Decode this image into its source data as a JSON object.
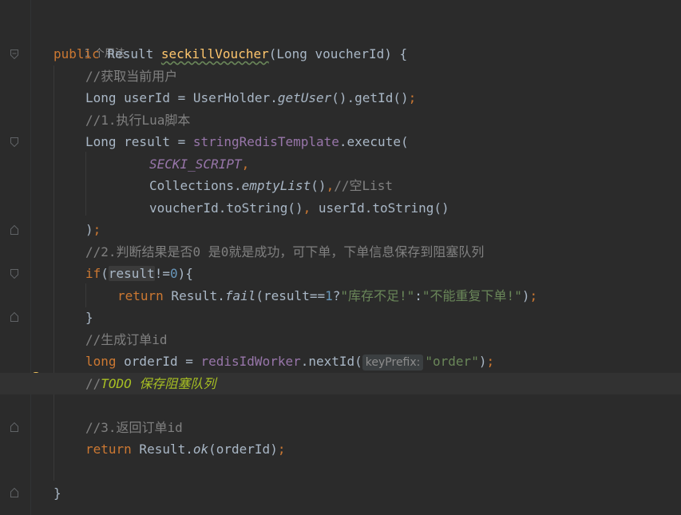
{
  "editor": {
    "usage_hint": "1 个用法",
    "lines": {
      "l1_kw": "public",
      "l1_type": " Result ",
      "l1_method": "seckillVoucher",
      "l1_rest": "(Long voucherId) {",
      "l2": "//获取当前用户",
      "l3_a": "Long userId = UserHolder.",
      "l3_b": "getUser",
      "l3_c": "().getId()",
      "l3_semi": ";",
      "l4": "//1.执行Lua脚本",
      "l5_a": "Long result = ",
      "l5_b": "stringRedisTemplate",
      "l5_c": ".execute(",
      "l6_a": "SECKI_SCRIPT",
      "l6_b": ",",
      "l7_a": "Collections.",
      "l7_b": "emptyList",
      "l7_c": "()",
      "l7_d": ",",
      "l7_e": "//空List",
      "l8_a": "voucherId.toString()",
      "l8_b": ", ",
      "l8_c": "userId.toString()",
      "l9_a": ")",
      "l9_b": ";",
      "l10": "//2.判断结果是否0 是0就是成功，可下单，下单信息保存到阻塞队列",
      "l11_kw": "if",
      "l11_a": "(",
      "l11_b": "result",
      "l11_c": "!=",
      "l11_d": "0",
      "l11_e": "){",
      "l12_kw": "return",
      "l12_a": " Result.",
      "l12_b": "fail",
      "l12_c": "(result==",
      "l12_d": "1",
      "l12_e": "?",
      "l12_f": "\"库存不足!\"",
      "l12_g": ":",
      "l12_h": "\"不能重复下单!\"",
      "l12_i": ")",
      "l12_j": ";",
      "l13": "}",
      "l14": "//生成订单id",
      "l15_kw": "long",
      "l15_a": " orderId = ",
      "l15_b": "redisIdWorker",
      "l15_c": ".nextId(",
      "l15_hint": "keyPrefix:",
      "l15_d": "\"order\"",
      "l15_e": ")",
      "l15_f": ";",
      "l16_a": "//",
      "l16_b": "TODO 保存阻塞队列",
      "l18": "//3.返回订单id",
      "l19_kw": "return",
      "l19_a": " Result.",
      "l19_b": "ok",
      "l19_c": "(orderId)",
      "l19_d": ";",
      "l21": "}"
    }
  },
  "colors": {
    "background": "#2b2b2b",
    "keyword": "#cc7832",
    "comment": "#808080",
    "field": "#9876aa",
    "string": "#6a8759",
    "number": "#6897bb",
    "todo": "#a8c023",
    "method_decl": "#ffc66d",
    "text": "#a9b7c6"
  },
  "icons": {
    "fold": "fold-marker-icon",
    "intention": "lightbulb-icon"
  }
}
